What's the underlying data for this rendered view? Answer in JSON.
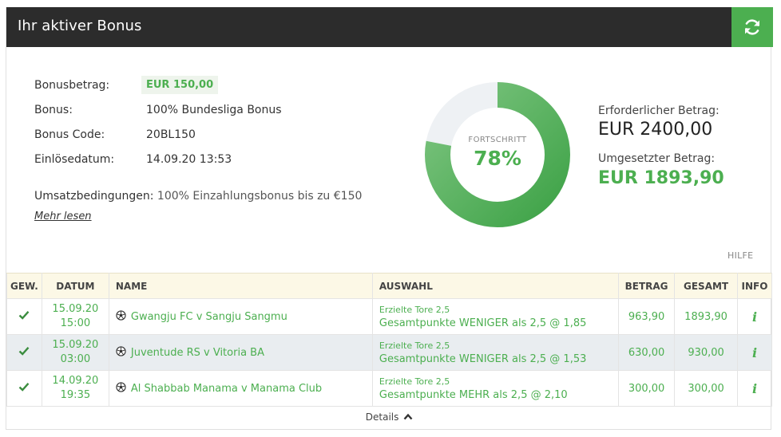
{
  "header": {
    "title": "Ihr aktiver Bonus",
    "refresh_icon": "refresh-icon"
  },
  "bonus": {
    "amount_label": "Bonusbetrag:",
    "amount_value": "EUR 150,00",
    "bonus_label": "Bonus:",
    "bonus_value": "100% Bundesliga Bonus",
    "code_label": "Bonus Code:",
    "code_value": "20BL150",
    "date_label": "Einlösedatum:",
    "date_value": "14.09.20 13:53",
    "terms_label": "Umsatzbedingungen:",
    "terms_value": "100% Einzahlungsbonus bis zu €150",
    "more_link": "Mehr lesen"
  },
  "progress": {
    "label": "FORTSCHRITT",
    "value_text": "78%",
    "fraction": 0.78,
    "accent": "#4caf50",
    "track": "#eef1f4"
  },
  "amounts": {
    "required_label": "Erforderlicher Betrag:",
    "required_value": "EUR 2400,00",
    "achieved_label": "Umgesetzter Betrag:",
    "achieved_value": "EUR 1893,90"
  },
  "help_link": "HILFE",
  "table": {
    "headers": [
      "GEW.",
      "DATUM",
      "NAME",
      "AUSWAHL",
      "BETRAG",
      "GESAMT",
      "INFO"
    ],
    "rows": [
      {
        "status": "check-icon",
        "date": "15.09.20",
        "time": "15:00",
        "name": "Gwangju FC v Sangju Sangmu",
        "market": "Erzielte Tore 2,5",
        "selection": "Gesamtpunkte WENIGER als 2,5 @ 1,85",
        "stake": "963,90",
        "total": "1893,90",
        "info": "i"
      },
      {
        "status": "check-icon",
        "date": "15.09.20",
        "time": "03:00",
        "name": "Juventude RS v Vitoria BA",
        "market": "Erzielte Tore 2,5",
        "selection": "Gesamtpunkte WENIGER als 2,5 @ 1,53",
        "stake": "630,00",
        "total": "930,00",
        "info": "i"
      },
      {
        "status": "check-icon",
        "date": "14.09.20",
        "time": "19:35",
        "name": "Al Shabbab Manama v Manama Club",
        "market": "Erzielte Tore 2,5",
        "selection": "Gesamtpunkte MEHR als 2,5 @ 2,10",
        "stake": "300,00",
        "total": "300,00",
        "info": "i"
      }
    ]
  },
  "details_toggle": "Details",
  "colors": {
    "accent": "#4caf50",
    "header_bg": "#2c2c2c",
    "table_header_bg": "#fcf8e6",
    "alt_row_bg": "#e9edf0"
  }
}
